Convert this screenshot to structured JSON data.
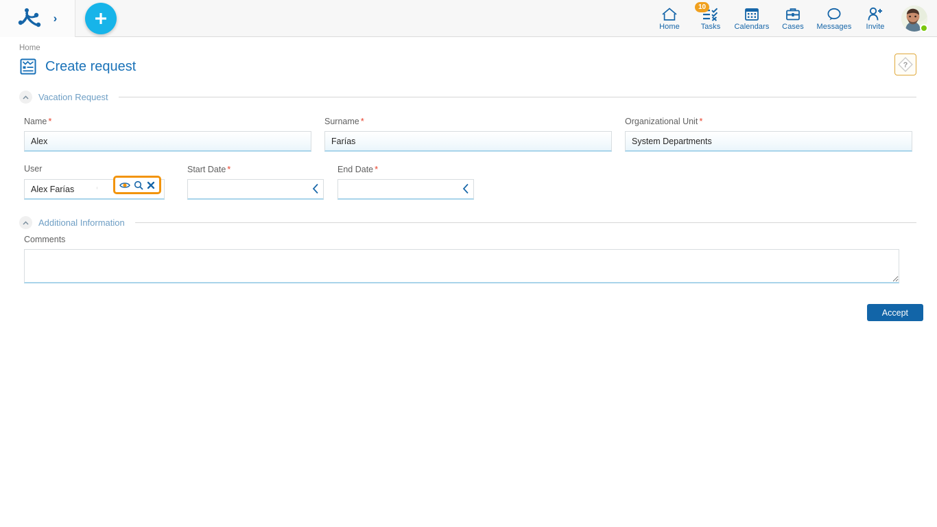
{
  "topbar": {
    "logo_name": "app-logo",
    "expand_arrow": "›",
    "add_button_label": "+",
    "nav": [
      {
        "label": "Home",
        "icon": "home-icon",
        "badge": null
      },
      {
        "label": "Tasks",
        "icon": "tasks-icon",
        "badge": "10"
      },
      {
        "label": "Calendars",
        "icon": "calendar-icon",
        "badge": null
      },
      {
        "label": "Cases",
        "icon": "briefcase-icon",
        "badge": null
      },
      {
        "label": "Messages",
        "icon": "chat-icon",
        "badge": null
      },
      {
        "label": "Invite",
        "icon": "user-plus-icon",
        "badge": null
      }
    ],
    "avatar_status": "online"
  },
  "header": {
    "breadcrumb": "Home",
    "title": "Create request",
    "title_icon": "form-document-icon",
    "help_icon": "help-diamond-icon"
  },
  "sections": [
    {
      "title": "Vacation Request"
    },
    {
      "title": "Additional Information"
    }
  ],
  "form": {
    "name": {
      "label": "Name",
      "required": true,
      "value": "Alex",
      "placeholder": ""
    },
    "surname": {
      "label": "Surname",
      "required": true,
      "value": "Farías",
      "placeholder": ""
    },
    "org_unit": {
      "label": "Organizational Unit",
      "required": true,
      "value": "System Departments",
      "placeholder": ""
    },
    "user": {
      "label": "User",
      "required": false,
      "value": "Alex Farías",
      "placeholder": ""
    },
    "start_date": {
      "label": "Start Date",
      "required": true,
      "value": "",
      "placeholder": ""
    },
    "end_date": {
      "label": "End Date",
      "required": true,
      "value": "",
      "placeholder": ""
    },
    "comments": {
      "label": "Comments",
      "value": "",
      "placeholder": ""
    },
    "lookup_icons": [
      "eye-icon",
      "search-icon",
      "clear-x-icon"
    ],
    "required_marker": "*"
  },
  "actions": {
    "accept_label": "Accept"
  },
  "colors": {
    "accent_blue": "#1265a8",
    "cyan": "#17b4e9",
    "badge_orange": "#f0a01e",
    "highlight_orange": "#f2940b",
    "required_red": "#e8402a",
    "field_underline": "#a8d4ea",
    "status_green": "#7ac70c"
  }
}
